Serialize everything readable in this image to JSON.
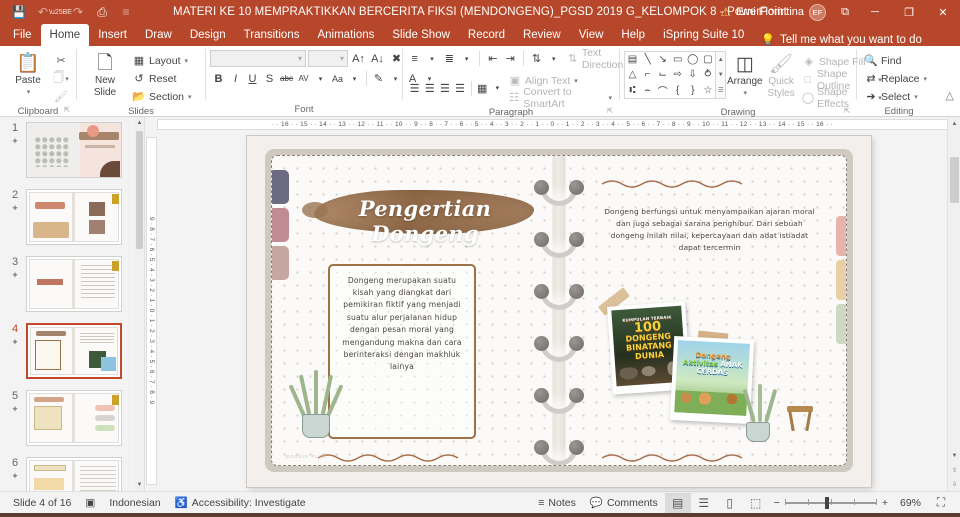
{
  "window": {
    "title": "MATERI KE 10 MEMPRAKTIKKAN BERCERITA FIKSI (MENDONGENG)_PGSD 2019 G_KELOMPOK 8",
    "separator": "-",
    "app": "PowerPoint",
    "account_name": "Erni Fiorintina",
    "account_initials": "EF",
    "warning_icon": "warning-triangle-icon",
    "accent_color": "#b7472a",
    "quick_access": [
      {
        "name": "save",
        "glyph": "💾"
      },
      {
        "name": "undo",
        "glyph": "↶"
      },
      {
        "name": "redo",
        "glyph": "↷"
      },
      {
        "name": "start-from-beginning",
        "glyph": "⎙"
      },
      {
        "name": "customize-quick-access-toolbar",
        "glyph": "≡"
      }
    ],
    "buttons": {
      "ribbon_display": "⧉",
      "minimize": "─",
      "restore": "❐",
      "close": "✕"
    }
  },
  "tabs": [
    {
      "label": "File",
      "active": false
    },
    {
      "label": "Home",
      "active": true
    },
    {
      "label": "Insert",
      "active": false
    },
    {
      "label": "Draw",
      "active": false
    },
    {
      "label": "Design",
      "active": false
    },
    {
      "label": "Transitions",
      "active": false
    },
    {
      "label": "Animations",
      "active": false
    },
    {
      "label": "Slide Show",
      "active": false
    },
    {
      "label": "Record",
      "active": false
    },
    {
      "label": "Review",
      "active": false
    },
    {
      "label": "View",
      "active": false
    },
    {
      "label": "Help",
      "active": false
    },
    {
      "label": "iSpring Suite 10",
      "active": false
    }
  ],
  "tell_me": "Tell me what you want to do",
  "ribbon": {
    "clipboard": {
      "label": "Clipboard",
      "paste": "Paste",
      "cut": "Cut",
      "copy": "Copy",
      "format_painter": "Format Painter"
    },
    "slides": {
      "label": "Slides",
      "new_slide": "New\nSlide",
      "new_slide_line1": "New",
      "new_slide_line2": "Slide",
      "layout": "Layout",
      "reset": "Reset",
      "section": "Section"
    },
    "font": {
      "label": "Font",
      "font_name": "",
      "font_size": "",
      "grow": "Increase Font Size",
      "shrink": "Decrease Font Size",
      "clear": "Clear All Formatting",
      "bold": "B",
      "italic": "I",
      "underline": "U",
      "shadow": "S",
      "strikethrough": "abc",
      "spacing": "AV",
      "change_case": "Aa",
      "highlight": "Text Highlight Color",
      "font_color": "A"
    },
    "paragraph": {
      "label": "Paragraph",
      "text_direction": "Text Direction",
      "align_text": "Align Text",
      "convert_smartart": "Convert to SmartArt"
    },
    "drawing": {
      "label": "Drawing",
      "arrange": "Arrange",
      "quick_styles_line1": "Quick",
      "quick_styles_line2": "Styles",
      "shape_fill": "Shape Fill",
      "shape_outline": "Shape Outline",
      "shape_effects": "Shape Effects",
      "shape_glyphs": [
        "▤",
        "╲",
        "↘",
        "▭",
        "◯",
        "▢",
        "△",
        "⌐",
        "⌙",
        "⇨",
        "⇩",
        "⥁",
        "⑆",
        "⌢",
        "⌒",
        "{",
        "}",
        "☆"
      ]
    },
    "editing": {
      "label": "Editing",
      "find": "Find",
      "replace": "Replace",
      "select": "Select",
      "collapse": "Collapse the Ribbon"
    }
  },
  "ruler": {
    "horizontal": "· · 16 · · 15 · · 14 · · 13 · · 12 · · 11 · · 10 · · 9 · · 8 · · 7 · · 6 · · 5 · · 4 · · 3 · · 2 · · 1 · · 0 · · 1 · · 2 · · 3 · · 4 · · 5 · · 6 · · 7 · · 8 · · 9 · · 10 · · 11 · · 12 · · 13 · · 14 · · 15 · · 16 · ·",
    "vertical": "9 · 8 · 7 · 6 · 5 · 4 · 3 · 2 · 1 · 0 · 1 · 2 · 3 · 4 · 5 · 6 · 7 · 8 · 9"
  },
  "thumbnails": [
    {
      "number": "1",
      "star": "✦",
      "selected": false
    },
    {
      "number": "2",
      "star": "✦",
      "selected": false
    },
    {
      "number": "3",
      "star": "✦",
      "selected": false
    },
    {
      "number": "4",
      "star": "✦",
      "selected": true
    },
    {
      "number": "5",
      "star": "✦",
      "selected": false
    },
    {
      "number": "6",
      "star": "✦",
      "selected": false
    }
  ],
  "slide": {
    "title": "Pengertian Dongeng",
    "left_text": "Dongeng merupakan suatu kisah yang diangkat dari pemikiran fiktif yang menjadi suatu alur perjalanan hidup dengan pesan moral yang mengandung makna dan cara berinteraksi dengan makhluk lainya",
    "right_text": "Dongeng berfungsi untuk menyampaikan ajaran moral dan juga sebagai sarana penghibur. Dari sebuah dongeng inilah nilai, kepercayaan dan adat istiadat dapat tercermin",
    "book_photo_1": {
      "count": "100",
      "kicker": "KUMPULAN TERBAIK",
      "line1": "DONGENG",
      "line2": "BINATANG",
      "line3": "DUNIA"
    },
    "book_photo_2": {
      "line1": "Dongeng",
      "line2": "Aktivitas",
      "line3": "ANAK CERDAS"
    },
    "watermark": "BOOKIE FLAG"
  },
  "status": {
    "slide_counter": "Slide 4 of 16",
    "notes_icon": "notes-page-icon",
    "language": "Indonesian",
    "accessibility": "Accessibility: Investigate",
    "notes": "Notes",
    "comments": "Comments",
    "views": [
      {
        "name": "normal-view",
        "glyph": "▤",
        "active": true
      },
      {
        "name": "slide-sorter-view",
        "glyph": "☰",
        "active": false
      },
      {
        "name": "reading-view",
        "glyph": "▯",
        "active": false
      },
      {
        "name": "slide-show-view",
        "glyph": "⬚",
        "active": false
      }
    ],
    "zoom_out": "−",
    "zoom_in": "+",
    "zoom_level": "69%",
    "fit_slide": "⛶"
  }
}
